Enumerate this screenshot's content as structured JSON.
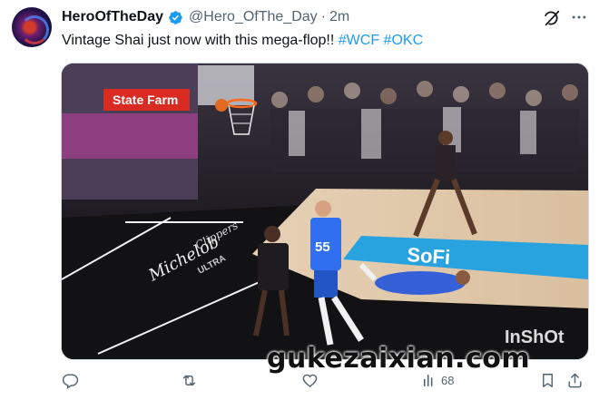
{
  "author": {
    "display_name": "HeroOfTheDay",
    "handle": "@Hero_OfThe_Day",
    "separator": "·",
    "time": "2m",
    "verified": true
  },
  "tweet": {
    "text": "Vintage Shai just now with this mega-flop!!",
    "hashtags": [
      "#WCF",
      "#OKC"
    ]
  },
  "media": {
    "type": "video-frame",
    "court_signage": [
      "State Farm",
      "SoFi",
      "Michelob",
      "ULTRA",
      "Clippers"
    ],
    "player_jersey_number": "55",
    "app_watermark": "InShOt"
  },
  "actions": {
    "reply_count": "",
    "repost_count": "",
    "like_count": "",
    "views_count": "68"
  },
  "overlay_watermark": "gukezaixian.com",
  "colors": {
    "hashtag": "#1d9bf0",
    "verified_badge": "#1d9bf0",
    "secondary_text": "#536471"
  }
}
